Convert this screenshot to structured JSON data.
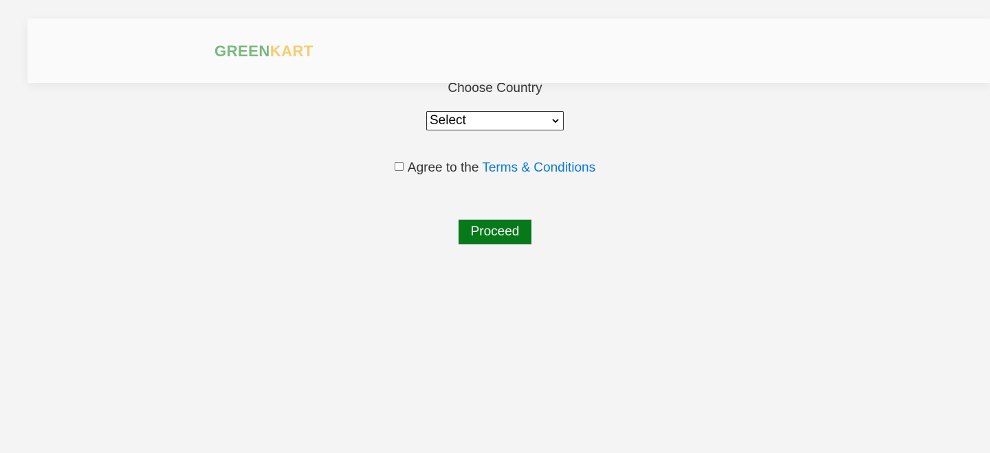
{
  "header": {
    "logo_part1": "GREEN",
    "logo_part2": "KART",
    "logo_color_green": "#7ab87e",
    "logo_color_kart": "#f7cc6f"
  },
  "form": {
    "country_label": "Choose Country",
    "country_select": {
      "selected": "Select",
      "options": [
        "Select"
      ]
    },
    "terms": {
      "checked": false,
      "prefix": "Agree to the ",
      "link_text": "Terms & Conditions",
      "link_color": "#0a7ad9"
    },
    "proceed_label": "Proceed",
    "proceed_color": "#07791a"
  }
}
